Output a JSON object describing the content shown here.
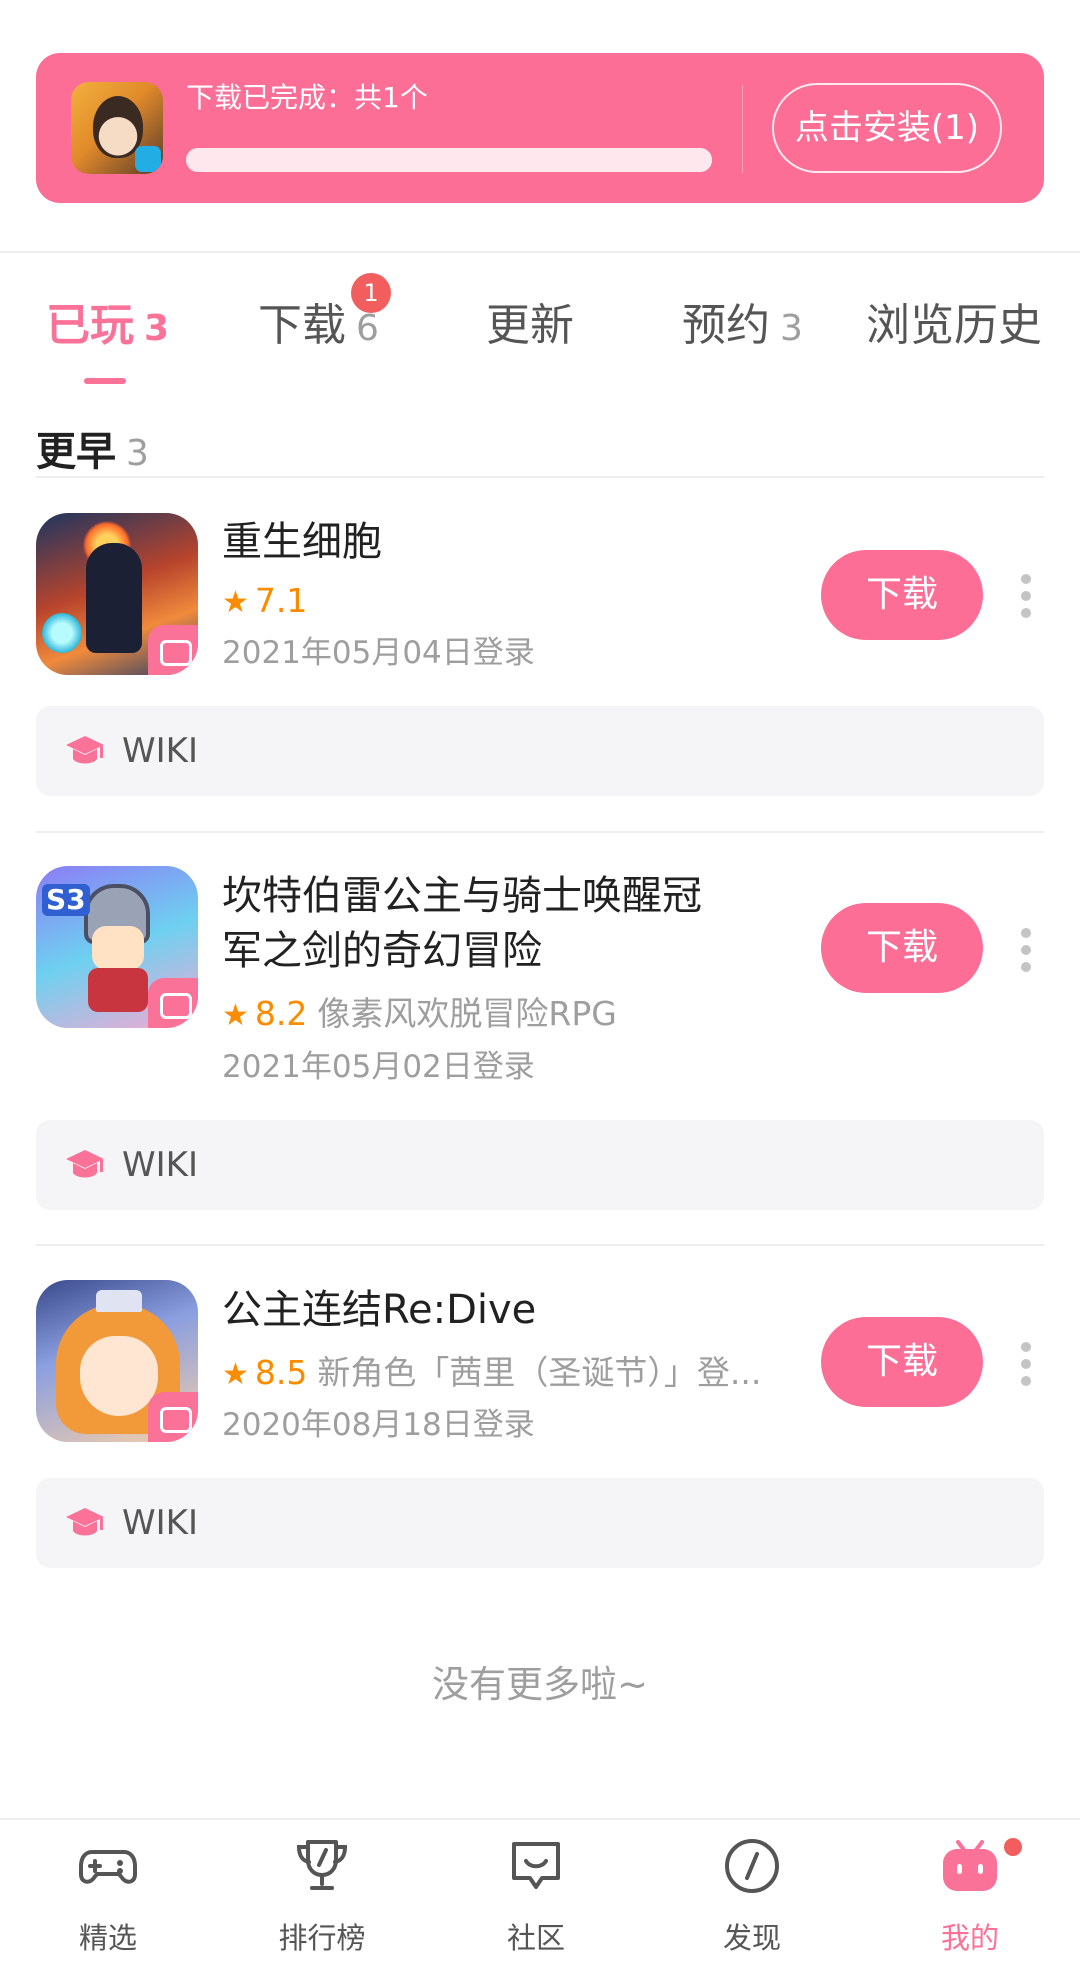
{
  "banner": {
    "title": "下载已完成：共1个",
    "progress": 1.0,
    "install_label": "点击安装(1)",
    "icon": "download-game-icon"
  },
  "tabs": [
    {
      "label": "已玩",
      "count": "3",
      "active": true
    },
    {
      "label": "下载",
      "count": "6",
      "badge": "1"
    },
    {
      "label": "更新",
      "count": ""
    },
    {
      "label": "预约",
      "count": "3"
    },
    {
      "label": "浏览历史",
      "count": ""
    }
  ],
  "section": {
    "title": "更早",
    "count": "3"
  },
  "games": [
    {
      "name_line1": "重生细胞",
      "name_line2": "",
      "score": "7.1",
      "tagline": "",
      "login": "2021年05月04日登录",
      "download_label": "下载",
      "wiki_label": "WIKI"
    },
    {
      "name_line1": "坎特伯雷公主与骑士唤醒冠",
      "name_line2": "军之剑的奇幻冒险",
      "score": "8.2",
      "tagline": "像素风欢脱冒险RPG",
      "login": "2021年05月02日登录",
      "download_label": "下载",
      "wiki_label": "WIKI"
    },
    {
      "name_line1": "公主连结Re:Dive",
      "name_line2": "",
      "score": "8.5",
      "tagline": "新角色「茜里（圣诞节）」登...",
      "login": "2020年08月18日登录",
      "download_label": "下载",
      "wiki_label": "WIKI"
    }
  ],
  "footer_text": "没有更多啦~",
  "bottom_nav": [
    {
      "label": "精选",
      "icon": "gamepad-icon"
    },
    {
      "label": "排行榜",
      "icon": "trophy-icon"
    },
    {
      "label": "社区",
      "icon": "chat-icon"
    },
    {
      "label": "发现",
      "icon": "compass-icon"
    },
    {
      "label": "我的",
      "icon": "bilibili-tv-icon",
      "active": true
    }
  ],
  "colors": {
    "accent": "#fb7299",
    "banner": "#fc6e96",
    "rating": "#fb8c00",
    "badge": "#f25d5d"
  }
}
